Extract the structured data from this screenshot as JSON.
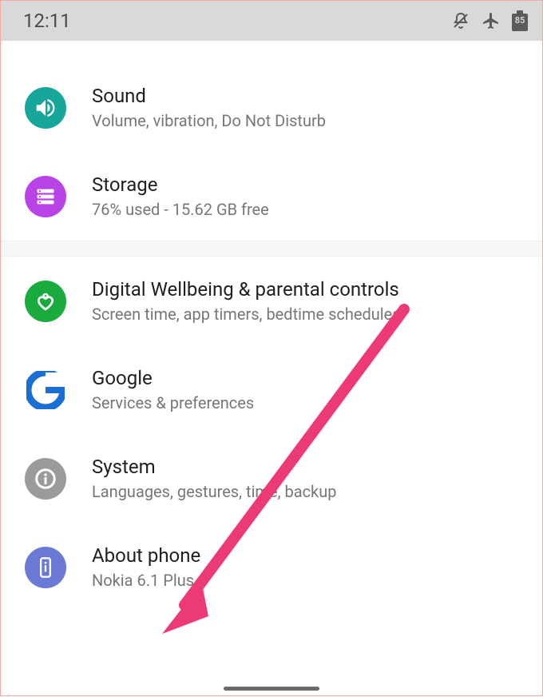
{
  "status": {
    "time": "12:11",
    "battery_percent": "85"
  },
  "settings": [
    {
      "name": "sound",
      "title": "Sound",
      "subtitle": "Volume, vibration, Do Not Disturb",
      "icon": "volume-icon",
      "bg": "#17a69a"
    },
    {
      "name": "storage",
      "title": "Storage",
      "subtitle": "76% used - 15.62 GB free",
      "icon": "storage-icon",
      "bg": "#b943e6"
    },
    {
      "name": "wellbeing",
      "title": "Digital Wellbeing & parental controls",
      "subtitle": "Screen time, app timers, bedtime schedules",
      "icon": "heart-icon",
      "bg": "#1aab3f"
    },
    {
      "name": "google",
      "title": "Google",
      "subtitle": "Services & preferences",
      "icon": "google-icon",
      "bg": "#ffffff"
    },
    {
      "name": "system",
      "title": "System",
      "subtitle": "Languages, gestures, time, backup",
      "icon": "info-icon",
      "bg": "#9b9b9b"
    },
    {
      "name": "about",
      "title": "About phone",
      "subtitle": "Nokia 6.1 Plus",
      "icon": "phone-icon",
      "bg": "#6a79d4"
    }
  ],
  "annotation": {
    "type": "arrow",
    "color": "#ec3a77"
  }
}
